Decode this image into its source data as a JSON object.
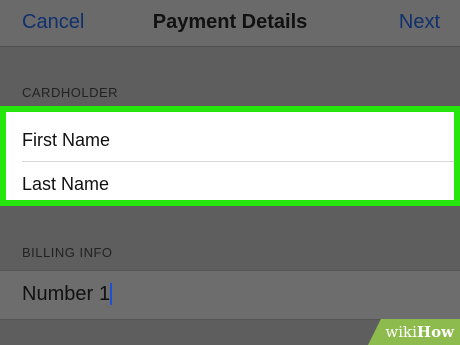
{
  "nav": {
    "cancel_label": "Cancel",
    "title": "Payment Details",
    "next_label": "Next"
  },
  "cardholder": {
    "header": "CARDHOLDER",
    "first_name_placeholder": "First Name",
    "last_name_placeholder": "Last Name"
  },
  "billing": {
    "header": "BILLING INFO",
    "number_label": "Number",
    "number_value": "1"
  },
  "watermark": {
    "text_light": "wiki",
    "text_bold": "How"
  },
  "colors": {
    "highlight": "#27e60d",
    "link": "#10306e",
    "caret": "#1d4fd6"
  }
}
